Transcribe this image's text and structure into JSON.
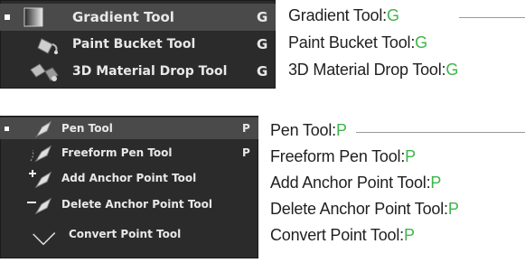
{
  "panel_a": {
    "items": [
      {
        "label": "Gradient Tool",
        "shortcut": "G",
        "icon": "gradient-icon",
        "selected": true
      },
      {
        "label": "Paint Bucket Tool",
        "shortcut": "G",
        "icon": "paint-bucket-icon",
        "selected": false
      },
      {
        "label": "3D Material Drop Tool",
        "shortcut": "G",
        "icon": "3d-material-drop-icon",
        "selected": false
      }
    ]
  },
  "panel_b": {
    "items": [
      {
        "label": "Pen Tool",
        "shortcut": "P",
        "icon": "pen-icon",
        "selected": true
      },
      {
        "label": "Freeform Pen Tool",
        "shortcut": "P",
        "icon": "freeform-pen-icon",
        "selected": false
      },
      {
        "label": "Add Anchor Point Tool",
        "shortcut": "",
        "icon": "add-anchor-point-icon",
        "selected": false
      },
      {
        "label": "Delete Anchor Point Tool",
        "shortcut": "",
        "icon": "delete-anchor-point-icon",
        "selected": false
      },
      {
        "label": "Convert Point Tool",
        "shortcut": "",
        "icon": "convert-point-icon",
        "selected": false
      }
    ]
  },
  "annotations_a": [
    {
      "name": "Gradient Tool:",
      "key": "G"
    },
    {
      "name": "Paint Bucket Tool:",
      "key": "G"
    },
    {
      "name": "3D Material Drop Tool:",
      "key": "G"
    }
  ],
  "annotations_b": [
    {
      "name": "Pen Tool:",
      "key": "P"
    },
    {
      "name": "Freeform Pen Tool:",
      "key": "P"
    },
    {
      "name": "Add Anchor Point Tool:",
      "key": "P"
    },
    {
      "name": "Delete Anchor Point Tool:",
      "key": "P"
    },
    {
      "name": "Convert Point Tool:",
      "key": "P"
    }
  ],
  "colors": {
    "shortcut_accent": "#3db54a",
    "menu_bg": "#2b2b2b",
    "menu_selected": "#4a4a4a"
  }
}
